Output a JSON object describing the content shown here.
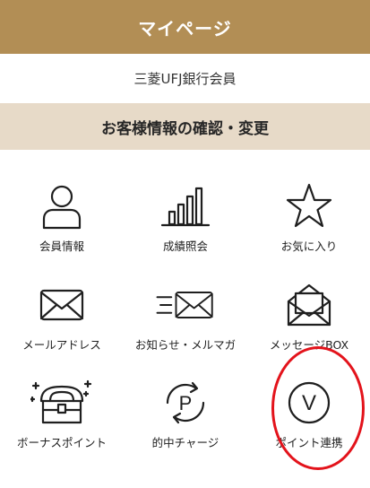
{
  "header": {
    "title": "マイページ"
  },
  "member": {
    "label": "三菱UFJ銀行会員"
  },
  "section": {
    "title": "お客様情報の確認・変更"
  },
  "menu": [
    {
      "label": "会員情報",
      "icon": "person-icon"
    },
    {
      "label": "成績照会",
      "icon": "bar-chart-icon"
    },
    {
      "label": "お気に入り",
      "icon": "star-icon"
    },
    {
      "label": "メールアドレス",
      "icon": "mail-icon"
    },
    {
      "label": "お知らせ・メルマガ",
      "icon": "mail-lines-icon"
    },
    {
      "label": "メッセージBOX",
      "icon": "open-mail-icon"
    },
    {
      "label": "ボーナスポイント",
      "icon": "treasure-chest-icon"
    },
    {
      "label": "的中チャージ",
      "icon": "p-charge-icon",
      "glyph": "P"
    },
    {
      "label": "ポイント連携",
      "icon": "v-circle-icon",
      "glyph": "V"
    }
  ],
  "colors": {
    "header": "#b28e55",
    "section": "#e7dac8",
    "highlight": "#e3131b"
  }
}
